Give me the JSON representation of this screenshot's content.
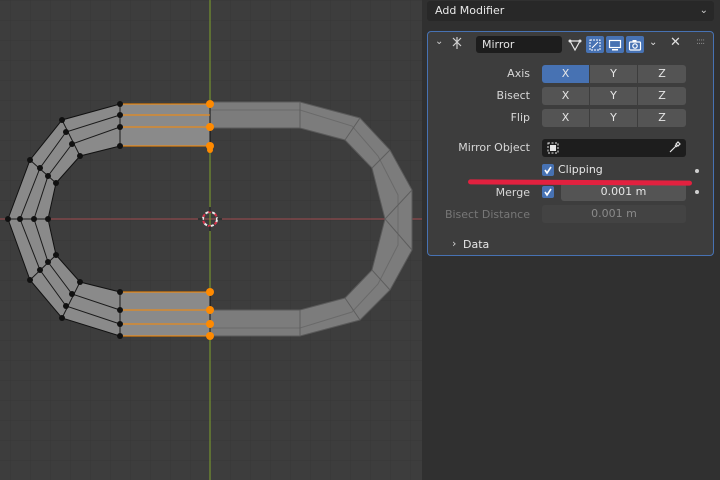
{
  "panel": {
    "add_modifier": "Add Modifier",
    "modifier_name": "Mirror",
    "axis": {
      "label": "Axis",
      "x": "X",
      "y": "Y",
      "z": "Z"
    },
    "bisect": {
      "label": "Bisect",
      "x": "X",
      "y": "Y",
      "z": "Z"
    },
    "flip": {
      "label": "Flip",
      "x": "X",
      "y": "Y",
      "z": "Z"
    },
    "mirror_object_label": "Mirror Object",
    "clipping_label": "Clipping",
    "merge_label": "Merge",
    "merge_value": "0.001 m",
    "bisect_distance_label": "Bisect Distance",
    "bisect_distance_value": "0.001 m",
    "data_section": "Data"
  },
  "colors": {
    "accent": "#4772b3",
    "selected_vertex": "#ff8a00",
    "annotation_line": "#e2213f",
    "x_axis": "#a14a4f",
    "y_axis": "#7fa32b"
  },
  "icons": [
    "modifier-icon",
    "chevron-down-icon",
    "edit-mode-icon",
    "cage-icon",
    "viewport-icon",
    "render-icon",
    "close-icon",
    "drag-handle-icon",
    "eyedropper-icon",
    "object-icon",
    "checkbox-icon",
    "chevron-right-icon",
    "3d-cursor-icon"
  ]
}
